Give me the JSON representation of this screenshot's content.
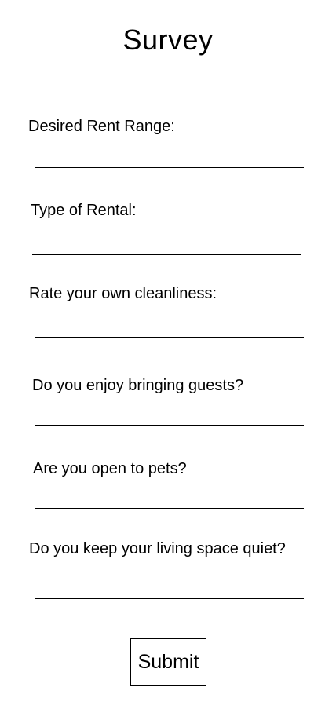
{
  "page": {
    "title": "Survey"
  },
  "questions": [
    {
      "label": "Desired Rent Range:"
    },
    {
      "label": "Type of Rental:"
    },
    {
      "label": "Rate your own cleanliness:"
    },
    {
      "label": "Do you enjoy bringing guests?"
    },
    {
      "label": "Are you open to pets?"
    },
    {
      "label": "Do you keep your living space quiet?"
    }
  ],
  "form": {
    "submit_label": "Submit"
  }
}
